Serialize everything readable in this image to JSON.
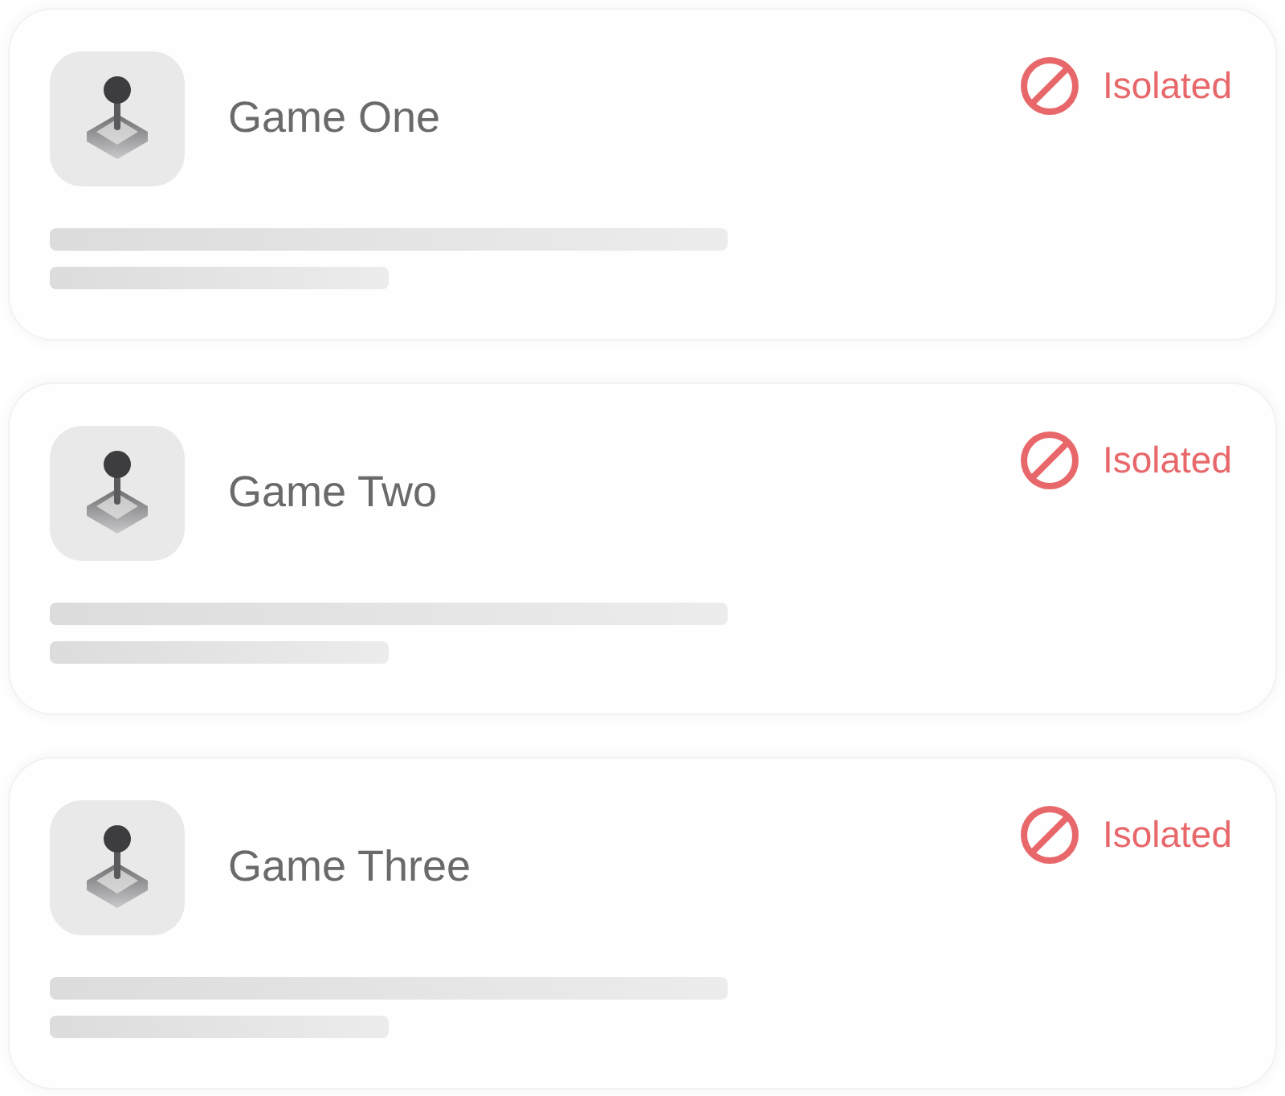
{
  "games": [
    {
      "title": "Game One",
      "status": {
        "kind": "isolated",
        "label": "Isolated"
      }
    },
    {
      "title": "Game Two",
      "status": {
        "kind": "isolated",
        "label": "Isolated"
      }
    },
    {
      "title": "Game Three",
      "status": {
        "kind": "isolated",
        "label": "Isolated"
      }
    }
  ]
}
